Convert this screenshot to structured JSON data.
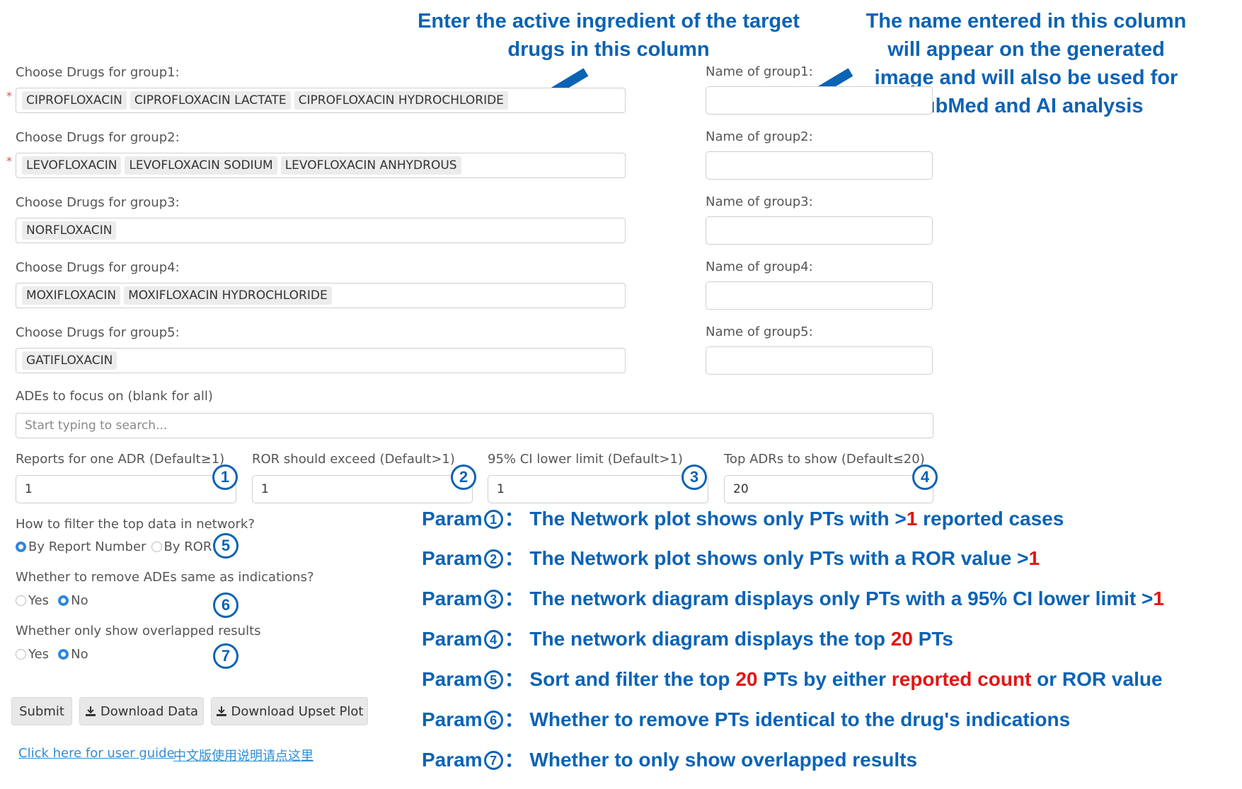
{
  "annotations": {
    "left_line1": "Enter the active ingredient of the target",
    "left_line2": "drugs in this column",
    "right_line1": "The name entered in this column",
    "right_line2": "will appear on the generated",
    "right_line3": "image and will also be used for",
    "right_line4": "PubMed and AI analysis"
  },
  "groups": [
    {
      "label": "Choose Drugs for group1:",
      "name_label": "Name of group1:",
      "required": "*",
      "drugs": [
        "CIPROFLOXACIN",
        "CIPROFLOXACIN LACTATE",
        "CIPROFLOXACIN HYDROCHLORIDE"
      ]
    },
    {
      "label": "Choose Drugs for group2:",
      "name_label": "Name of group2:",
      "required": "*",
      "drugs": [
        "LEVOFLOXACIN",
        "LEVOFLOXACIN SODIUM",
        "LEVOFLOXACIN ANHYDROUS"
      ]
    },
    {
      "label": "Choose Drugs for group3:",
      "name_label": "Name of group3:",
      "required": "",
      "drugs": [
        "NORFLOXACIN"
      ]
    },
    {
      "label": "Choose Drugs for group4:",
      "name_label": "Name of group4:",
      "required": "",
      "drugs": [
        "MOXIFLOXACIN",
        "MOXIFLOXACIN HYDROCHLORIDE"
      ]
    },
    {
      "label": "Choose Drugs for group5:",
      "name_label": "Name of group5:",
      "required": "",
      "drugs": [
        "GATIFLOXACIN"
      ]
    }
  ],
  "ade": {
    "label": "ADEs to focus on (blank for all)",
    "placeholder": "Start typing to search..."
  },
  "params": [
    {
      "label": "Reports for one ADR (Default≥1)",
      "value": "1",
      "marker": "1"
    },
    {
      "label": "ROR should exceed (Default>1)",
      "value": "1",
      "marker": "2"
    },
    {
      "label": "95% CI lower limit (Default>1)",
      "value": "1",
      "marker": "3"
    },
    {
      "label": "Top ADRs to show (Default≤20)",
      "value": "20",
      "marker": "4"
    }
  ],
  "filter": {
    "label": "How to filter the top data in network?",
    "opt1": "By Report Number",
    "opt2": "By ROR",
    "selected": "By Report Number",
    "marker": "5"
  },
  "remove_ind": {
    "label": "Whether to remove ADEs same as indications?",
    "opt1": "Yes",
    "opt2": "No",
    "selected": "No",
    "marker": "6"
  },
  "overlap": {
    "label": "Whether only show overlapped results",
    "opt1": "Yes",
    "opt2": "No",
    "selected": "No",
    "marker": "7"
  },
  "buttons": {
    "submit": "Submit",
    "download_data": "Download Data",
    "download_upset": "Download Upset Plot"
  },
  "links": {
    "guide_en": "Click here for user guide",
    "guide_zh": "中文版使用说明请点这里"
  },
  "param_notes": [
    {
      "prefix": "Param",
      "num": "1",
      "sep": "：",
      "pre": "The Network plot shows only PTs with >",
      "hl": "1",
      "post": " reported cases",
      "hl2": "",
      "post2": ""
    },
    {
      "prefix": "Param",
      "num": "2",
      "sep": "：",
      "pre": "The Network plot shows only PTs with a ROR value >",
      "hl": "1",
      "post": "",
      "hl2": "",
      "post2": ""
    },
    {
      "prefix": "Param",
      "num": "3",
      "sep": "：",
      "pre": "The network diagram displays only PTs with a 95% CI lower limit >",
      "hl": "1",
      "post": "",
      "hl2": "",
      "post2": ""
    },
    {
      "prefix": "Param",
      "num": "4",
      "sep": "：",
      "pre": "The network diagram displays the top ",
      "hl": "20",
      "post": " PTs",
      "hl2": "",
      "post2": ""
    },
    {
      "prefix": "Param",
      "num": "5",
      "sep": "：",
      "pre": "Sort and filter the top ",
      "hl": "20",
      "post": " PTs by either ",
      "hl2": "reported count",
      "post2": " or ROR value"
    },
    {
      "prefix": "Param",
      "num": "6",
      "sep": "：",
      "pre": "Whether to remove PTs identical to the drug's indications",
      "hl": "",
      "post": "",
      "hl2": "",
      "post2": ""
    },
    {
      "prefix": "Param",
      "num": "7",
      "sep": "：",
      "pre": "Whether to only show overlapped results",
      "hl": "",
      "post": "",
      "hl2": "",
      "post2": ""
    }
  ],
  "colors": {
    "annotation_blue": "#0b63b5",
    "highlight_red": "#e31515",
    "radio_blue": "#2e86de"
  },
  "icons": {
    "arrow": "arrow-icon",
    "download": "download-icon"
  }
}
